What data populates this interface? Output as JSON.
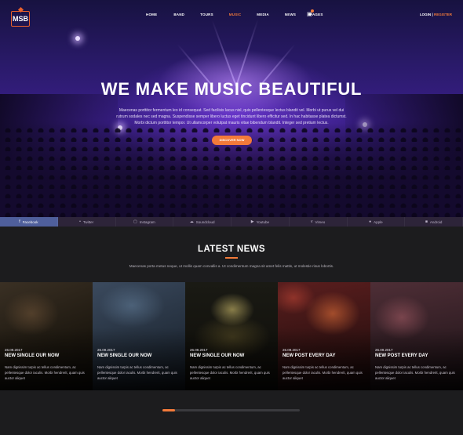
{
  "brand": {
    "logo_text": "MSB",
    "accent": "#f27a3a"
  },
  "nav": {
    "items": [
      {
        "label": "HOME",
        "active": false
      },
      {
        "label": "BAND",
        "active": false
      },
      {
        "label": "TOURS",
        "active": false
      },
      {
        "label": "MUSIC",
        "active": true
      },
      {
        "label": "MEDIA",
        "active": false
      },
      {
        "label": "NEWS",
        "active": false
      },
      {
        "label": "PAGES",
        "active": false
      }
    ],
    "login": "LOGIN",
    "separator": "|",
    "register": "REGISTER"
  },
  "hero": {
    "title": "WE MAKE MUSIC BEAUTIFUL",
    "text": "Maecenas porttitor fermentum leo id consequat. Sed facilisis lacus nisl, quis pellentesque lectus blandit vel. Morbi ut purus vel dui rutrum sodales nec sed magna. Suspendisse semper libero luctus eget tincidunt libero efficitur sed. In hac habitasse platea dictumst. Morbi dictum porttitor tempor. Ut ullamcorper volutpat mauris vitae bibendum blandit. Integer sed pretium lectus.",
    "button": "DISCOVER NOW"
  },
  "social": [
    {
      "icon": "facebook-icon",
      "glyph": "f",
      "label": "Facebook",
      "active": true
    },
    {
      "icon": "twitter-icon",
      "glyph": "•",
      "label": "Twitter",
      "active": false
    },
    {
      "icon": "instagram-icon",
      "glyph": "▢",
      "label": "Instagram",
      "active": false
    },
    {
      "icon": "soundcloud-icon",
      "glyph": "☁",
      "label": "Soundcloud",
      "active": false
    },
    {
      "icon": "youtube-icon",
      "glyph": "▶",
      "label": "Youtube",
      "active": false
    },
    {
      "icon": "vimeo-icon",
      "glyph": "v",
      "label": "Vimeo",
      "active": false
    },
    {
      "icon": "apple-icon",
      "glyph": "●",
      "label": "Apple",
      "active": false
    },
    {
      "icon": "android-icon",
      "glyph": "■",
      "label": "Android",
      "active": false
    }
  ],
  "news": {
    "title": "LATEST NEWS",
    "subtitle": "Maecenas porta metus neque, ut mollis quam convallis a. Ut condimentum magna sit amet felis mattis, ut molestie risus lobortis.",
    "cards": [
      {
        "date": "26.09.2017",
        "title": "NEW SINGLE OUR NOW",
        "text": "Nam dignissim turpis ac tellus condimentum, ac pellentesque dolor iaculis. Morbi hendrerit, quam quis auctor aliquet",
        "tone": "#2a2419"
      },
      {
        "date": "26.09.2017",
        "title": "NEW SINGLE OUR NOW",
        "text": "Nam dignissim turpis ac tellus condimentum, ac pellentesque dolor iaculis. Morbi hendrerit, quam quis auctor aliquet",
        "tone": "#2a3a4c"
      },
      {
        "date": "26.09.2017",
        "title": "NEW SINGLE OUR NOW",
        "text": "Nam dignissim turpis ac tellus condimentum, ac pellentesque dolor iaculis. Morbi hendrerit, quam quis auctor aliquet",
        "tone": "#1c1a12"
      },
      {
        "date": "26.09.2017",
        "title": "NEW POST EVERY DAY",
        "text": "Nam dignissim turpis ac tellus condimentum, ac pellentesque dolor iaculis. Morbi hendrerit, quam quis auctor aliquet",
        "tone": "#3a1818"
      },
      {
        "date": "26.09.2017",
        "title": "NEW POST EVERY DAY",
        "text": "Nam dignissim turpis ac tellus condimentum, ac pellentesque dolor iaculis. Morbi hendrerit, quam quis auctor aliquet",
        "tone": "#3a2226"
      }
    ]
  }
}
